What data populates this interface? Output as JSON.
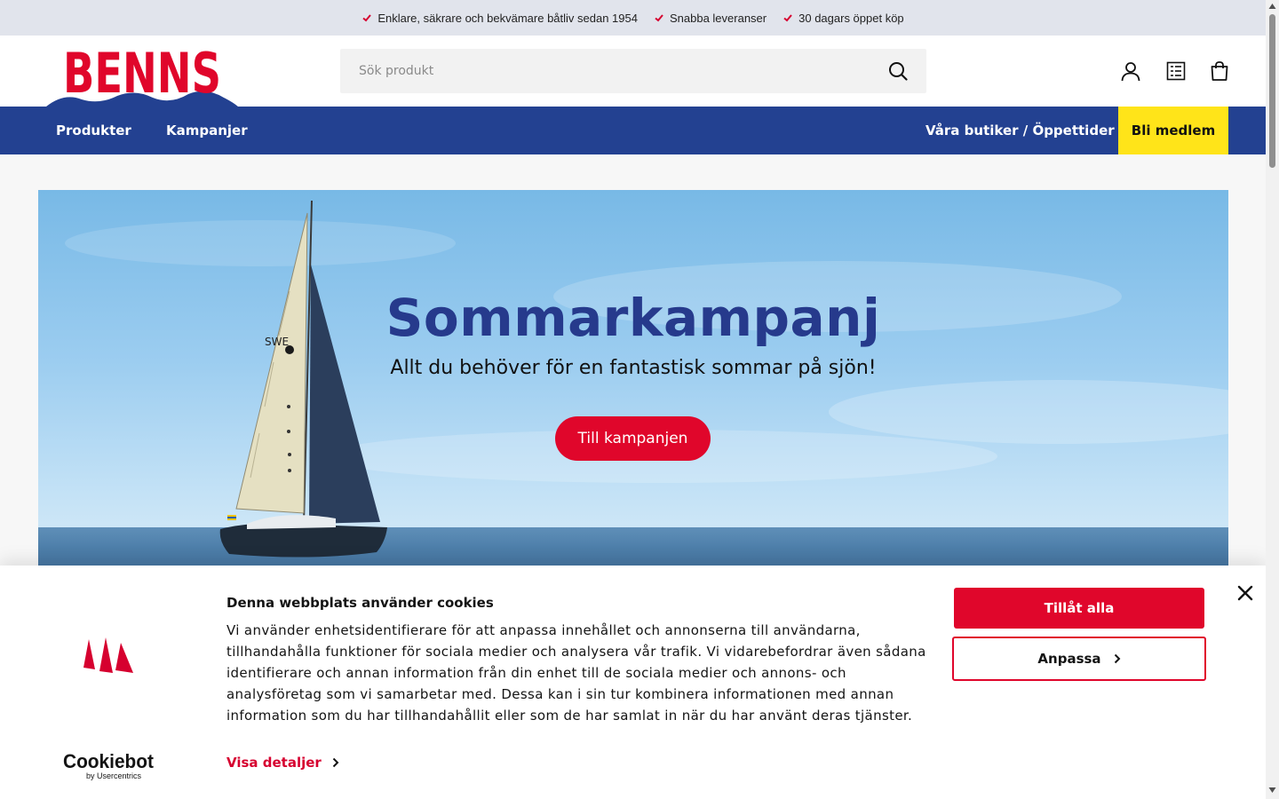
{
  "usp_bar": {
    "items": [
      "Enklare, säkrare och bekvämare båtliv sedan 1954",
      "Snabba leveranser",
      "30 dagars öppet köp"
    ]
  },
  "header": {
    "logo_text": "BENNS",
    "search": {
      "placeholder": "Sök produkt",
      "value": ""
    },
    "icons": [
      "user-icon",
      "wishlist-icon",
      "cart-icon"
    ]
  },
  "nav": {
    "left": [
      "Produkter",
      "Kampanjer"
    ],
    "stores": "Våra butiker / Öppettider",
    "member": "Bli medlem"
  },
  "hero": {
    "title": "Sommarkampanj",
    "subtitle": "Allt du behöver för en fantastisk sommar på sjön!",
    "cta": "Till kampanjen",
    "sail_text": "SWE"
  },
  "cookie_banner": {
    "title": "Denna webbplats använder cookies",
    "body": "Vi använder enhetsidentifierare för att anpassa innehållet och annonserna till användarna, tillhandahålla funktioner för sociala medier och analysera vår trafik. Vi vidarebefordrar även sådana identifierare och annan information från din enhet till de sociala medier och annons- och analysföretag som vi samarbetar med. Dessa kan i sin tur kombinera informationen med annan information som du har tillhandahållit eller som de har samlat in när du har använt deras tjänster.",
    "details": "Visa detaljer",
    "allow_all": "Tillåt alla",
    "customize": "Anpassa",
    "provider": "Cookiebot",
    "provider_sub": "by Usercentrics"
  },
  "colors": {
    "brand_red": "#e0062b",
    "nav_blue": "#234191",
    "member_yellow": "#ffe419",
    "hero_title": "#263a8c"
  }
}
